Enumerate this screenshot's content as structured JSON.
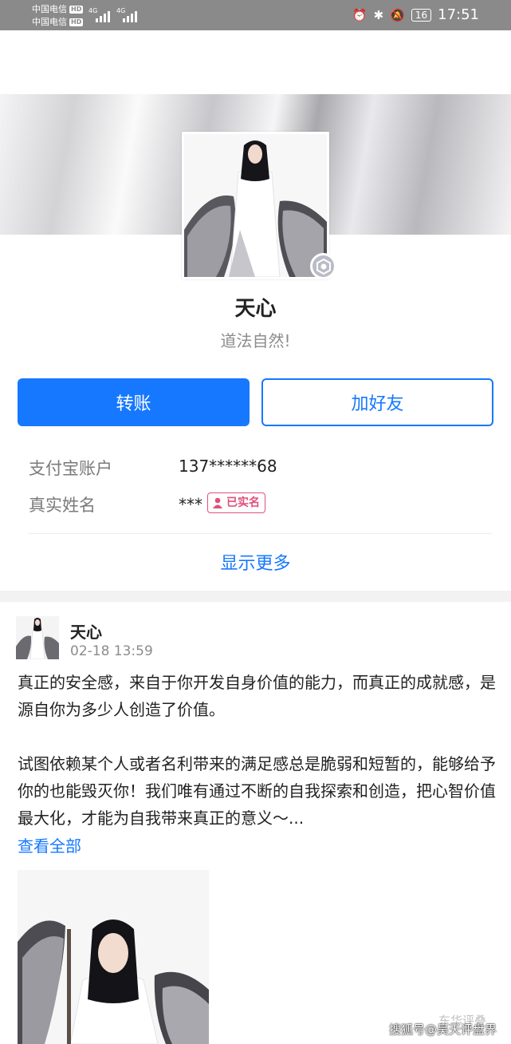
{
  "status_bar": {
    "carrier1": "中国电信",
    "carrier2": "中国电信",
    "hd": "HD",
    "signal_label": "4G",
    "battery": "16",
    "time": "17:51"
  },
  "profile": {
    "name": "天心",
    "motto": "道法自然!",
    "transfer_button": "转账",
    "add_friend_button": "加好友",
    "account_label": "支付宝账户",
    "account_value": "137******68",
    "realname_label": "真实姓名",
    "realname_value": "***",
    "verified_badge": "已实名",
    "show_more": "显示更多"
  },
  "post": {
    "author": "天心",
    "time": "02-18 13:59",
    "paragraph1": "真正的安全感，来自于你开发自身价值的能力，而真正的成就感，是源自你为多少人创造了价值。",
    "paragraph2": "试图依赖某个人或者名利带来的满足感总是脆弱和短暂的，能够给予你的也能毁灭你！我们唯有通过不断的自我探索和创造，把心智价值最大化，才能为自我带来真正的意义～...",
    "see_all": "查看全部"
  },
  "overlay": {
    "watermark": "东华评叠",
    "source": "搜狐号@昊天评盘界"
  },
  "colors": {
    "accent": "#1678ff",
    "verified": "#e0507a",
    "status_bar": "#8a8a8a"
  },
  "icons": {
    "alarm": "alarm-icon",
    "bluetooth": "bluetooth-icon",
    "silent": "bell-off-icon",
    "badge": "shield-badge-icon"
  }
}
